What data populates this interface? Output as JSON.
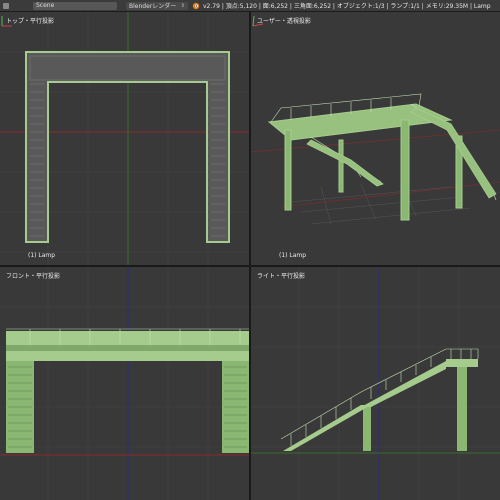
{
  "header": {
    "scene_label": "Scene",
    "engine_label": "Blenderレンダー",
    "stats": "v2.79 | 頂点:5,120 | 面:6,252 | 三角面:6,252 | オブジェクト:1/3 | ランプ:1/1 | メモリ:29.35M | Lamp"
  },
  "viewports": {
    "top": {
      "title": "トップ・平行投影",
      "object": "(1) Lamp"
    },
    "user": {
      "title": "ユーザー・透視投影",
      "object": "(1) Lamp"
    },
    "front": {
      "title": "フロント・平行投影"
    },
    "right": {
      "title": "ライト・平行投影"
    }
  },
  "colors": {
    "background": "#393939",
    "grid": "#404040",
    "model": "#a5cc8d",
    "model_dark": "#7fa86a",
    "axis_x": "#8a2a2a",
    "axis_y": "#3b6b2a",
    "axis_z": "#2c2c8a"
  }
}
